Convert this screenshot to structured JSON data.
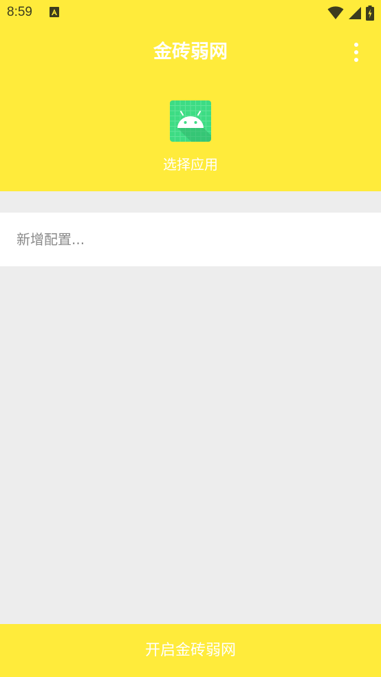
{
  "status_bar": {
    "time": "8:59",
    "icons": [
      "notification-a-icon",
      "wifi-icon",
      "cell-signal-icon",
      "battery-charging-icon"
    ]
  },
  "toolbar": {
    "title": "金砖弱网",
    "menu_icon": "more-vert-icon"
  },
  "app_picker": {
    "icon": "android-app-icon",
    "label": "选择应用"
  },
  "config": {
    "placeholder": "新增配置...",
    "value": ""
  },
  "footer": {
    "start_label": "开启金砖弱网"
  },
  "colors": {
    "primary": "#ffeb3b",
    "background": "#ededed",
    "card": "#ffffff",
    "text_on_primary": "#ffffff",
    "hint_text": "#8a8a8a",
    "status_icons": "#3c3c1e",
    "app_icon_green": "#3ddc84"
  }
}
